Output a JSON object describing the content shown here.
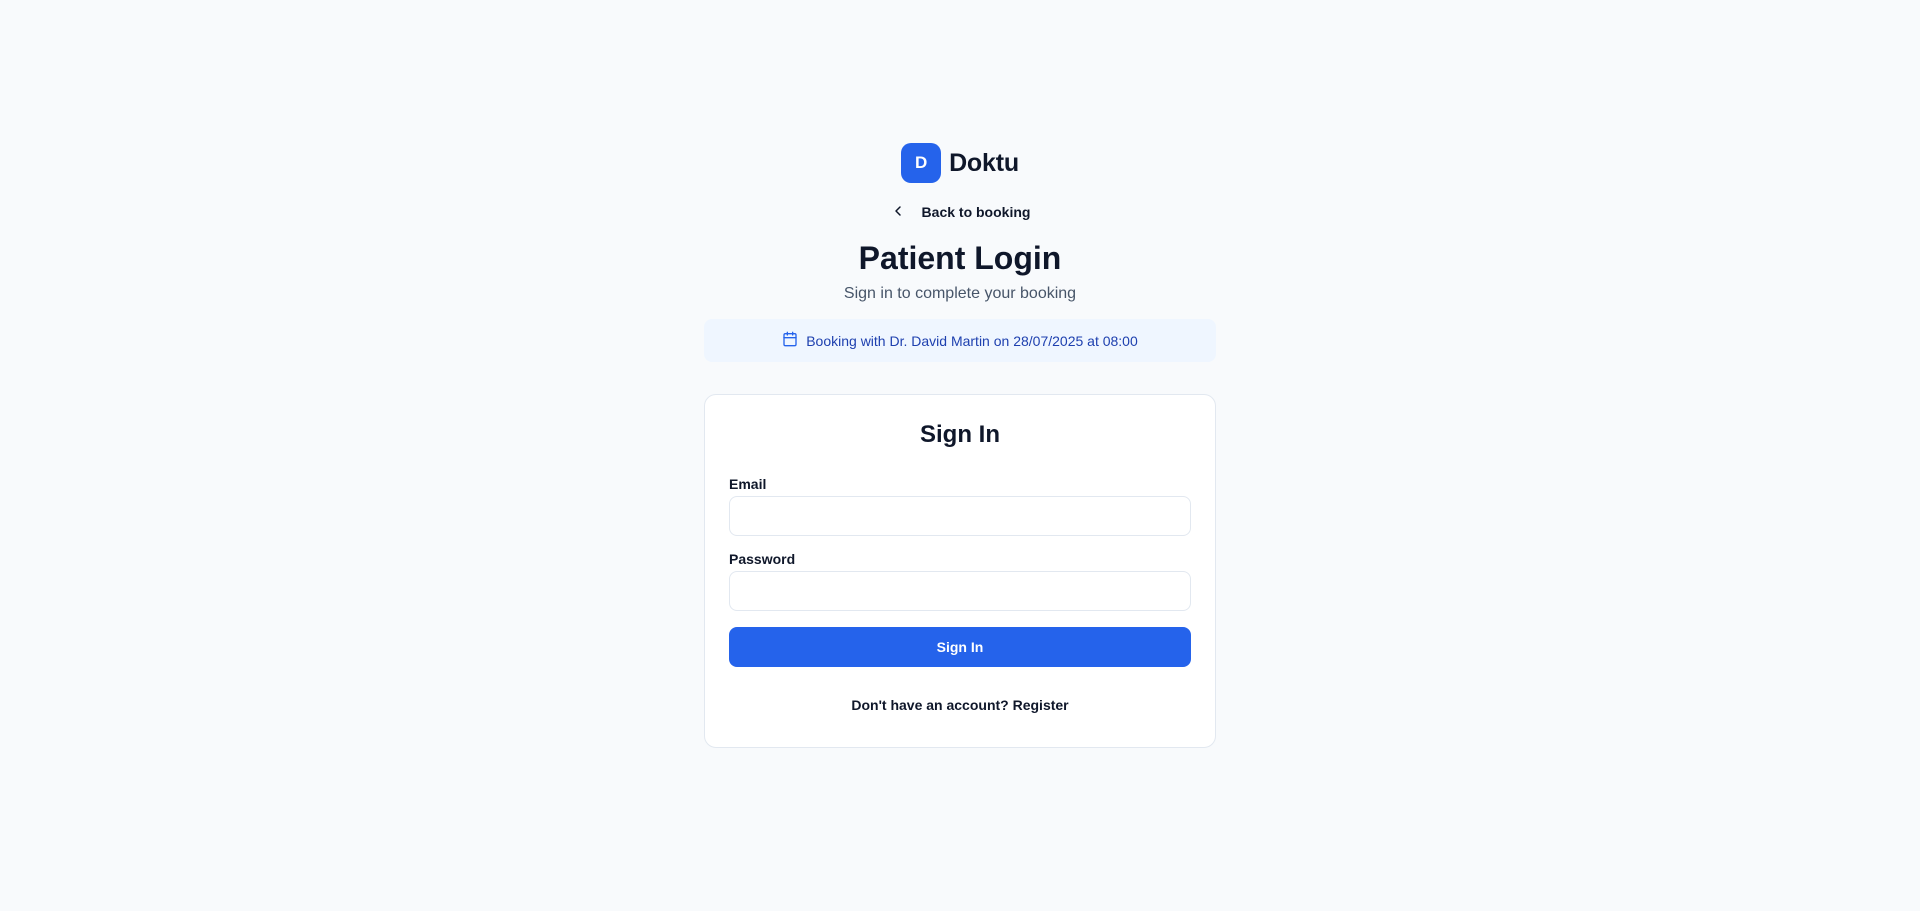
{
  "brand": {
    "logo_letter": "D",
    "name": "Doktu",
    "accent_color": "#2563eb"
  },
  "back_link": {
    "icon": "chevron-left-icon",
    "label": "Back to booking"
  },
  "header": {
    "title": "Patient Login",
    "subtitle": "Sign in to complete your booking"
  },
  "booking_info": {
    "icon": "calendar-icon",
    "text": "Booking with Dr. David Martin on 28/07/2025 at 08:00",
    "background_color": "#eff6ff",
    "text_color": "#1e40af"
  },
  "form": {
    "title": "Sign In",
    "email": {
      "label": "Email",
      "value": "",
      "placeholder": ""
    },
    "password": {
      "label": "Password",
      "value": "",
      "placeholder": ""
    },
    "submit_label": "Sign In",
    "register_prompt": "Don't have an account?",
    "register_link": "Register"
  }
}
